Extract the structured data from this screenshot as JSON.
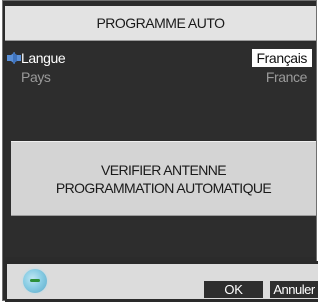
{
  "header": {
    "title": "PROGRAMME AUTO"
  },
  "settings": [
    {
      "label": "Langue",
      "value": "Français",
      "icon": "audio-speaker-icon"
    },
    {
      "label": "Pays",
      "value": "France"
    }
  ],
  "message": {
    "line1": "VERIFIER ANTENNE",
    "line2": "PROGRAMMATION AUTOMATIQUE"
  },
  "footer": {
    "icon": "globe-icon",
    "ok_label": "OK",
    "cancel_label": "Annuler"
  },
  "colors": {
    "panel_background": "#2b2b2b",
    "title_background": "#e3e3e3",
    "message_background": "#d4d4d4",
    "selected_value_background": "#ffffff"
  }
}
